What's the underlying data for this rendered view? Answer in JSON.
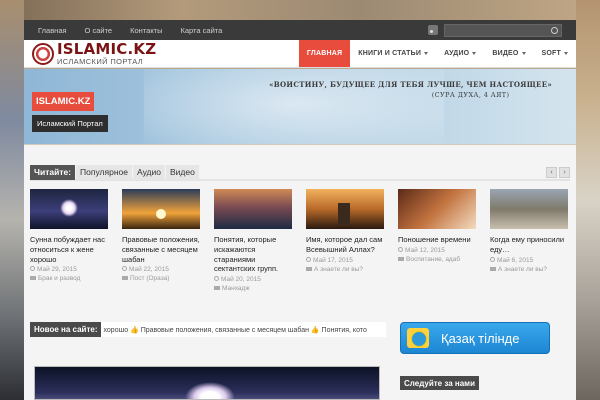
{
  "topbar": {
    "links": [
      "Главная",
      "О сайте",
      "Контакты",
      "Карта сайта"
    ]
  },
  "header": {
    "logo_title": "ISLAMIC.KZ",
    "logo_subtitle": "ИСЛАМСКИЙ ПОРТАЛ",
    "nav": [
      {
        "label": "ГЛАВНАЯ",
        "active": true,
        "dropdown": false
      },
      {
        "label": "КНИГИ И СТАТЬИ",
        "active": false,
        "dropdown": true
      },
      {
        "label": "АУДИО",
        "active": false,
        "dropdown": true
      },
      {
        "label": "ВИДЕО",
        "active": false,
        "dropdown": true
      },
      {
        "label": "SOFT",
        "active": false,
        "dropdown": true
      }
    ]
  },
  "banner": {
    "badge": "ISLAMIC.KZ",
    "caption": "Исламский Портал",
    "quote": "«ВОИСТИНУ, БУДУЩЕЕ ДЛЯ ТЕБЯ ЛУЧШЕ, ЧЕМ НАСТОЯЩЕЕ»",
    "quote_source": "(СУРА ДУХА, 4 АЯТ)"
  },
  "reads": {
    "label": "Читайте:",
    "tabs": [
      "Популярное",
      "Аудио",
      "Видео"
    ],
    "prev": "‹",
    "next": "›"
  },
  "posts": [
    {
      "title": "Сунна побуждает нас относиться к жене хорошо",
      "date": "Май 29, 2015",
      "category": "Брак и развод"
    },
    {
      "title": "Правовые положения, связанные с месяцем шабан",
      "date": "Май 22, 2015",
      "category": "Пост (Ораза)"
    },
    {
      "title": "Понятия, которые искажаются стараниями сектантских групп.",
      "date": "Май 20, 2015",
      "category": "Манхадж"
    },
    {
      "title": "Имя, которое дал сам Всевышний Аллах?",
      "date": "Май 17, 2015",
      "category": "А знаете ли вы?"
    },
    {
      "title": "Поношение времени",
      "date": "Май 12, 2015",
      "category": "Воспитание, адаб"
    },
    {
      "title": "Когда ему приносили еду…",
      "date": "Май 6, 2015",
      "category": "А знаете ли вы?"
    }
  ],
  "news": {
    "label": "Новое на сайте:",
    "ticker": "хорошо  👍 Правовые положения, связанные с месяцем шабан   👍 Понятия, кото"
  },
  "sidebar": {
    "kazakh_label": "Қазақ тілінде",
    "follow_label": "Следуйте за нами"
  },
  "colors": {
    "accent": "#e74c3c",
    "dark": "#3a3a3a",
    "kazakh_blue": "#2a97e0"
  }
}
